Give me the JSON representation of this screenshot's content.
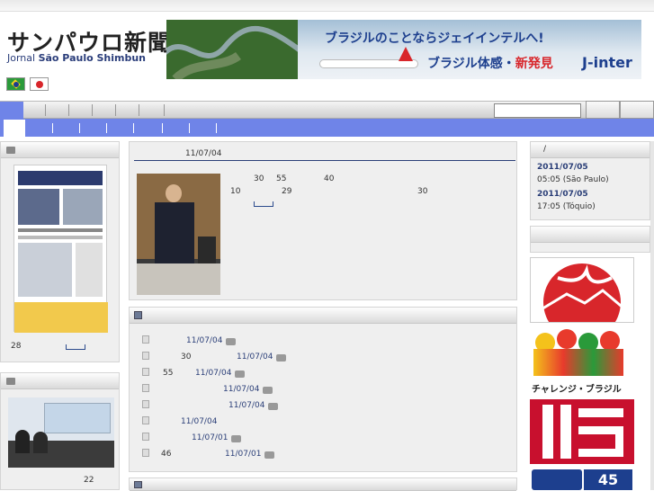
{
  "header": {
    "logo_jp": "サンパウロ新聞",
    "logo_en_prefix": "Jornal",
    "logo_en_name": "São Paulo Shimbun"
  },
  "banner": {
    "headline": "ブラジルのことならジェイインテルへ!",
    "sub_prefix": "ブラジル体感・",
    "sub_highlight": "新発見",
    "brand": "J-inter"
  },
  "flags": [
    "brazil-flag",
    "japan-flag"
  ],
  "main_article": {
    "date": "11/07/04",
    "lines": [
      {
        "a": "30",
        "b": "55",
        "c": "40"
      },
      {
        "a": "10",
        "b": "29",
        "c": "30"
      }
    ]
  },
  "left_panel1": {
    "count": "28"
  },
  "left_panel2": {
    "count": "22"
  },
  "news_list": [
    {
      "prefix": "",
      "date": "11/07/04",
      "cam": true
    },
    {
      "prefix": "30",
      "date": "11/07/04",
      "cam": true
    },
    {
      "prefix": "55",
      "date": "11/07/04",
      "cam": true
    },
    {
      "prefix": "",
      "date": "11/07/04",
      "cam": true
    },
    {
      "prefix": "",
      "date": "11/07/04",
      "cam": true
    },
    {
      "prefix": "",
      "date": "11/07/04",
      "cam": false
    },
    {
      "prefix": "",
      "date": "11/07/01",
      "cam": true
    },
    {
      "prefix": "46",
      "date": "11/07/01",
      "cam": true
    }
  ],
  "clock": {
    "title": "/",
    "sp_date": "2011/07/05",
    "sp_time": "05:05 (São Paulo)",
    "jp_date": "2011/07/05",
    "jp_time": "17:05 (Tóquio)"
  },
  "ads": {
    "challenge": "チャレンジ・ブラジル",
    "ad4": "45"
  },
  "colors": {
    "nav_blue": "#6f84e8",
    "link": "#2b3f78",
    "accent_red": "#d8262b"
  }
}
